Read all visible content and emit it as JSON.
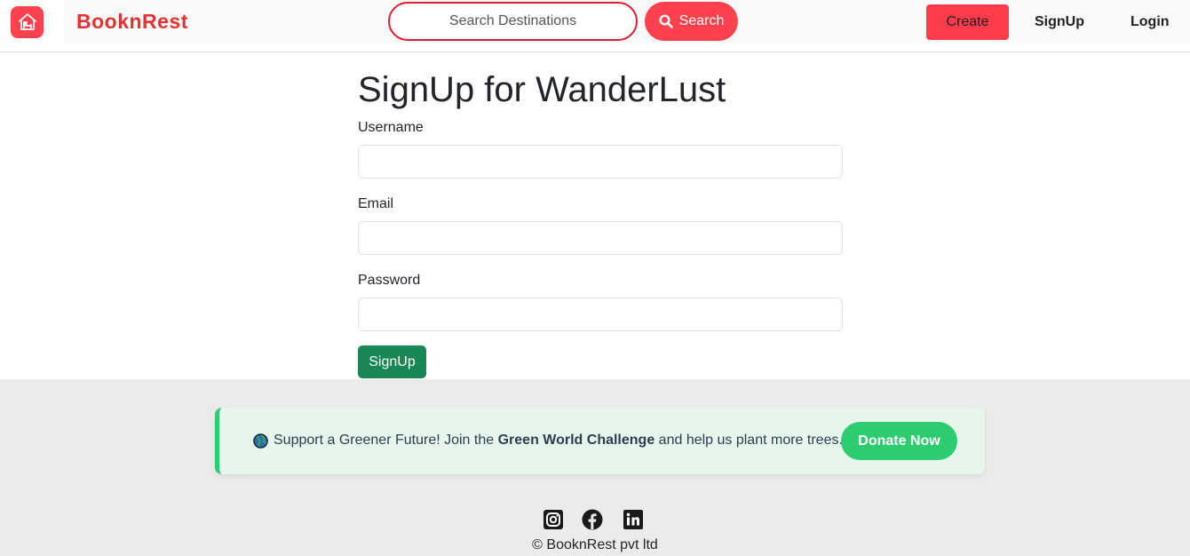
{
  "navbar": {
    "logo_icon": "home-bed-icon",
    "brand": "BooknRest",
    "search": {
      "placeholder": "Search Destinations",
      "button_label": "Search",
      "icon": "search-icon"
    },
    "create_label": "Create",
    "signup_label": "SignUp",
    "login_label": "Login",
    "accent_color": "#fe424d"
  },
  "form": {
    "title": "SignUp for WanderLust",
    "fields": [
      {
        "label": "Username",
        "value": ""
      },
      {
        "label": "Email",
        "value": ""
      },
      {
        "label": "Password",
        "value": ""
      }
    ],
    "submit_label": "SignUp",
    "submit_color": "#198754"
  },
  "footer": {
    "banner": {
      "globe_icon": "globe-icon",
      "text_before": "Support a Greener Future! Join the",
      "text_bold": "Green World Challenge",
      "text_after": "and help us plant more trees.",
      "button_label": "Donate Now",
      "accent_color": "#2ecc71"
    },
    "socials": [
      "instagram-icon",
      "facebook-icon",
      "linkedin-icon"
    ],
    "copyright": "© BooknRest pvt ltd"
  }
}
